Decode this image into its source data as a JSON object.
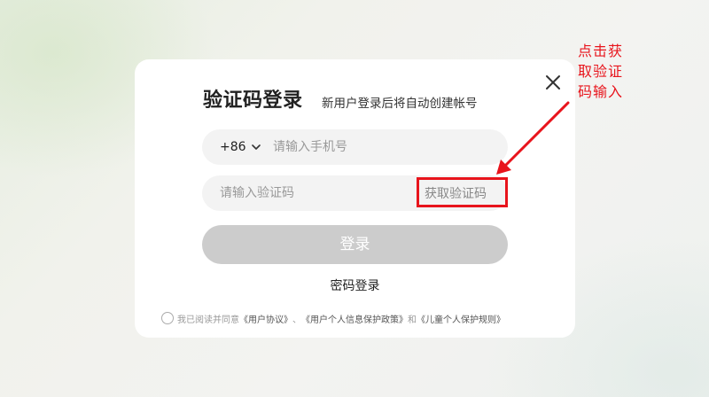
{
  "modal": {
    "title": "验证码登录",
    "subtitle": "新用户登录后将自动创建帐号",
    "close_icon": "close-icon"
  },
  "phone_field": {
    "country_code": "+86",
    "placeholder": "请输入手机号",
    "value": ""
  },
  "code_field": {
    "placeholder": "请输入验证码",
    "value": "",
    "get_code_label": "获取验证码"
  },
  "login_button": {
    "label": "登录"
  },
  "password_login": {
    "label": "密码登录"
  },
  "agreement": {
    "prefix": "我已阅读并同意",
    "user_agreement": "《用户协议》",
    "sep1": "、",
    "privacy_policy": "《用户个人信息保护政策》",
    "sep2": "和",
    "child_policy": "《儿童个人保护规则》"
  },
  "annotation": {
    "text": "点击获取验证码输入",
    "color": "#e8141c"
  },
  "colors": {
    "accent_red": "#e8141c",
    "button_disabled": "#cccccc",
    "field_bg": "#f3f3f3"
  }
}
